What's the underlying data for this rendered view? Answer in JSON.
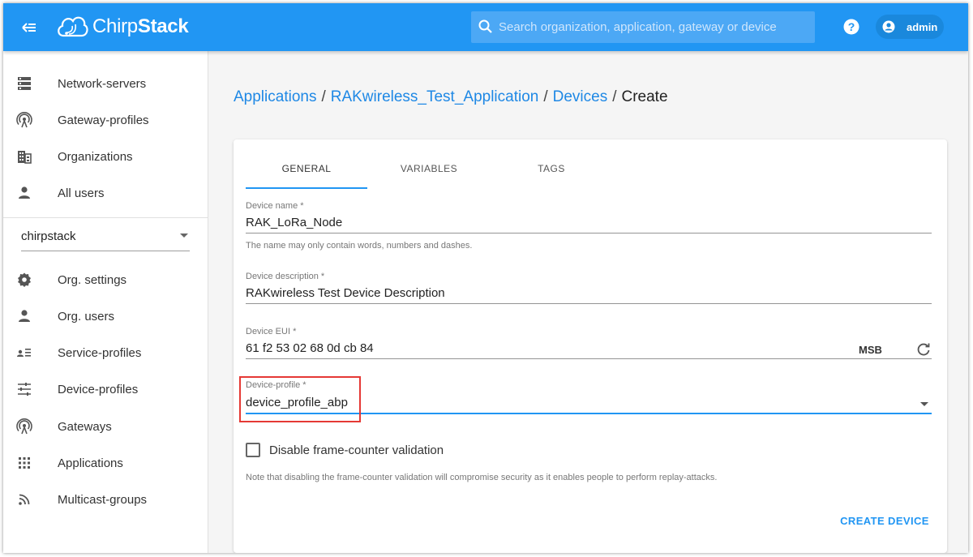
{
  "header": {
    "brand_light": "Chirp",
    "brand_bold": "Stack",
    "search_placeholder": "Search organization, application, gateway or device",
    "user": "admin"
  },
  "sidebar": {
    "admin_items": [
      {
        "label": "Network-servers",
        "icon": "server-icon"
      },
      {
        "label": "Gateway-profiles",
        "icon": "antenna-icon"
      },
      {
        "label": "Organizations",
        "icon": "building-icon"
      },
      {
        "label": "All users",
        "icon": "person-icon"
      }
    ],
    "org_select": "chirpstack",
    "org_items": [
      {
        "label": "Org. settings",
        "icon": "gear-icon"
      },
      {
        "label": "Org. users",
        "icon": "person-icon"
      },
      {
        "label": "Service-profiles",
        "icon": "person-list-icon"
      },
      {
        "label": "Device-profiles",
        "icon": "tune-icon"
      },
      {
        "label": "Gateways",
        "icon": "antenna-icon"
      },
      {
        "label": "Applications",
        "icon": "apps-grid-icon"
      },
      {
        "label": "Multicast-groups",
        "icon": "rss-icon"
      }
    ]
  },
  "breadcrumb": {
    "applications": "Applications",
    "app_name": "RAKwireless_Test_Application",
    "devices": "Devices",
    "current": "Create",
    "separator": "/"
  },
  "tabs": [
    "GENERAL",
    "VARIABLES",
    "TAGS"
  ],
  "form": {
    "device_name": {
      "label": "Device name *",
      "value": "RAK_LoRa_Node",
      "helper": "The name may only contain words, numbers and dashes."
    },
    "device_description": {
      "label": "Device description *",
      "value": "RAKwireless Test Device Description"
    },
    "device_eui": {
      "label": "Device EUI *",
      "value": "61 f2 53 02 68 0d cb 84",
      "byte_order": "MSB"
    },
    "device_profile": {
      "label": "Device-profile *",
      "value": "device_profile_abp"
    },
    "frame_counter_checkbox": {
      "label": "Disable frame-counter validation",
      "checked": false
    },
    "note": "Note that disabling the frame-counter validation will compromise security as it enables people to perform replay-attacks."
  },
  "create_button": "CREATE DEVICE",
  "colors": {
    "primary": "#2196f3",
    "highlight": "#e53935"
  }
}
